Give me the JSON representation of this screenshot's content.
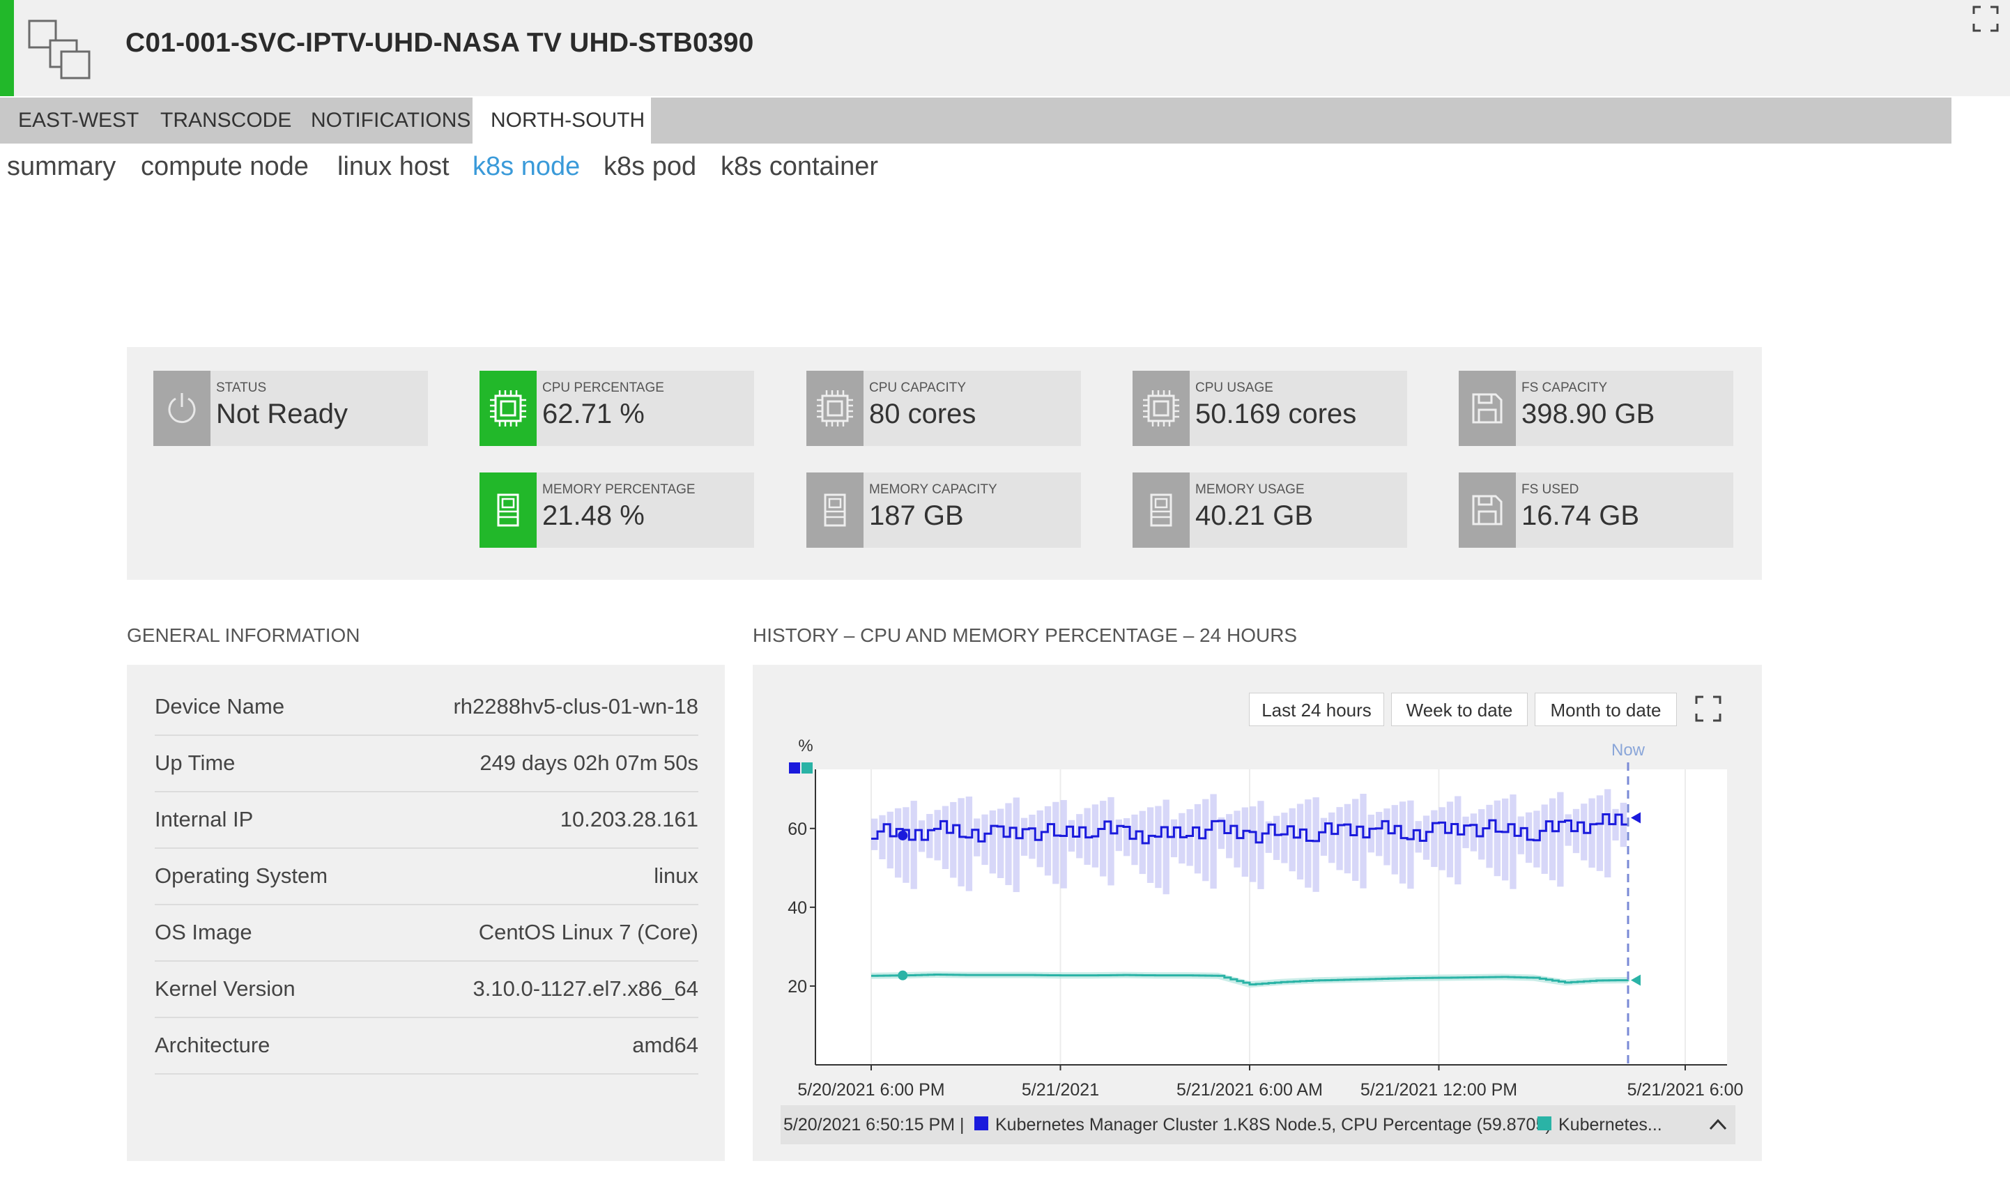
{
  "header": {
    "title": "C01-001-SVC-IPTV-UHD-NASA TV UHD-STB0390",
    "accent_color": "#22b82a",
    "icon": "device-group-icon"
  },
  "tabs": [
    {
      "label": "EAST-WEST",
      "active": false
    },
    {
      "label": "TRANSCODE",
      "active": false
    },
    {
      "label": "NOTIFICATIONS",
      "active": false
    },
    {
      "label": "NORTH-SOUTH",
      "active": true
    }
  ],
  "subnav": [
    {
      "label": "summary",
      "active": false
    },
    {
      "label": "compute node",
      "active": false
    },
    {
      "label": "linux host",
      "active": false
    },
    {
      "label": "k8s node",
      "active": true
    },
    {
      "label": "k8s pod",
      "active": false
    },
    {
      "label": "k8s container",
      "active": false
    }
  ],
  "metrics": {
    "status": {
      "label": "STATUS",
      "value": "Not Ready",
      "icon": "power-icon"
    },
    "cpu_percentage": {
      "label": "CPU PERCENTAGE",
      "value": "62.71 %",
      "icon": "cpu-icon"
    },
    "cpu_capacity": {
      "label": "CPU CAPACITY",
      "value": "80 cores",
      "icon": "cpu-icon"
    },
    "cpu_usage": {
      "label": "CPU USAGE",
      "value": "50.169 cores",
      "icon": "cpu-icon"
    },
    "fs_capacity": {
      "label": "FS CAPACITY",
      "value": "398.90 GB",
      "icon": "disk-icon"
    },
    "memory_percentage": {
      "label": "MEMORY PERCENTAGE",
      "value": "21.48 %",
      "icon": "memory-icon"
    },
    "memory_capacity": {
      "label": "MEMORY CAPACITY",
      "value": "187 GB",
      "icon": "memory-icon"
    },
    "memory_usage": {
      "label": "MEMORY USAGE",
      "value": "40.21 GB",
      "icon": "memory-icon"
    },
    "fs_used": {
      "label": "FS USED",
      "value": "16.74 GB",
      "icon": "disk-icon"
    }
  },
  "general": {
    "title": "GENERAL INFORMATION",
    "rows": [
      {
        "key": "Device Name",
        "value": "rh2288hv5-clus-01-wn-18"
      },
      {
        "key": "Up Time",
        "value": "249 days 02h 07m 50s"
      },
      {
        "key": "Internal IP",
        "value": "10.203.28.161"
      },
      {
        "key": "Operating System",
        "value": "linux"
      },
      {
        "key": "OS Image",
        "value": "CentOS Linux 7 (Core)"
      },
      {
        "key": "Kernel Version",
        "value": "3.10.0-1127.el7.x86_64"
      },
      {
        "key": "Architecture",
        "value": "amd64"
      }
    ]
  },
  "history": {
    "title": "HISTORY – CPU AND MEMORY PERCENTAGE – 24 HOURS",
    "range_buttons": [
      "Last 24 hours",
      "Week to date",
      "Month to date"
    ],
    "status_time": "5/20/2021 6:50:15 PM |",
    "status_series1": "Kubernetes Manager Cluster 1.K8S Node.5, CPU Percentage (59.8705)",
    "status_series2": "Kubernetes...",
    "colors": {
      "cpu": "#1a1adc",
      "memory": "#2ab3a6",
      "cpu_band": "#c9c9f5"
    }
  },
  "chart_data": {
    "type": "line",
    "ylabel": "%",
    "ylim": [
      0,
      75
    ],
    "yticks": [
      20,
      40,
      60
    ],
    "xticks": [
      "5/20/2021 6:00 PM",
      "5/21/2021",
      "5/21/2021 6:00 AM",
      "5/21/2021 12:00 PM",
      "5/21/2021 6:00"
    ],
    "now_label": "Now",
    "x_hours": [
      0,
      1,
      2,
      3,
      4,
      5,
      6,
      7,
      8,
      9,
      10,
      11,
      12,
      13,
      14,
      15,
      16,
      17,
      18,
      19,
      20,
      21,
      22,
      23,
      24
    ],
    "series": [
      {
        "values": [
          59.5,
          58.2,
          59.9,
          59.1,
          58.4,
          59.3,
          58.8,
          60.1,
          59.0,
          57.9,
          59.5,
          59.8,
          58.4,
          59.2,
          58.9,
          59.6,
          60.0,
          58.7,
          59.4,
          60.2,
          59.8,
          59.1,
          60.6,
          61.2,
          62.7
        ]
      },
      {
        "values": [
          22.6,
          22.7,
          22.9,
          22.8,
          22.8,
          22.8,
          22.7,
          22.7,
          22.8,
          22.7,
          22.7,
          22.6,
          20.4,
          21.0,
          21.4,
          21.6,
          21.8,
          22.0,
          22.1,
          22.2,
          22.3,
          22.1,
          20.9,
          21.4,
          21.5
        ]
      }
    ]
  }
}
